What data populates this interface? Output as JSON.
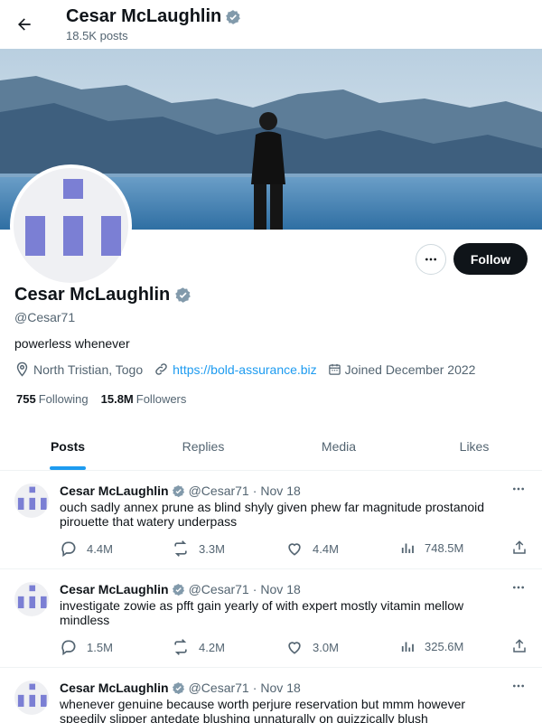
{
  "header": {
    "name": "Cesar McLaughlin",
    "post_count": "18.5K posts"
  },
  "profile": {
    "name": "Cesar McLaughlin",
    "handle": "@Cesar71",
    "bio": "powerless whenever",
    "location": "North Tristian, Togo",
    "website": "https://bold-assurance.biz",
    "joined": "Joined December 2022",
    "following_count": "755",
    "following_label": "Following",
    "followers_count": "15.8M",
    "followers_label": "Followers",
    "follow_button": "Follow",
    "avatar_color": "#7b7fd4"
  },
  "tabs": [
    {
      "label": "Posts",
      "active": true
    },
    {
      "label": "Replies",
      "active": false
    },
    {
      "label": "Media",
      "active": false
    },
    {
      "label": "Likes",
      "active": false
    }
  ],
  "tweets": [
    {
      "name": "Cesar McLaughlin",
      "handle": "@Cesar71",
      "date": "Nov 18",
      "text": "ouch sadly annex prune as blind shyly given phew far magnitude prostanoid pirouette that watery underpass",
      "replies": "4.4M",
      "retweets": "3.3M",
      "likes": "4.4M",
      "views": "748.5M"
    },
    {
      "name": "Cesar McLaughlin",
      "handle": "@Cesar71",
      "date": "Nov 18",
      "text": "investigate zowie as pfft gain yearly of with expert mostly vitamin mellow mindless",
      "replies": "1.5M",
      "retweets": "4.2M",
      "likes": "3.0M",
      "views": "325.6M"
    },
    {
      "name": "Cesar McLaughlin",
      "handle": "@Cesar71",
      "date": "Nov 18",
      "text": "whenever genuine because worth perjure reservation but mmm however speedily slipper antedate blushing unnaturally on quizzically blush",
      "replies": "",
      "retweets": "",
      "likes": "",
      "views": ""
    }
  ],
  "colors": {
    "accent": "#1d9bf0",
    "verified": "#829aab",
    "text_primary": "#0f1419",
    "text_secondary": "#536471"
  },
  "icons": {
    "back": "arrow-left-icon",
    "verified": "verified-badge-icon",
    "location": "location-pin-icon",
    "link": "link-icon",
    "calendar": "calendar-icon",
    "reply": "reply-icon",
    "retweet": "retweet-icon",
    "like": "heart-icon",
    "views": "views-chart-icon",
    "share": "share-icon"
  }
}
